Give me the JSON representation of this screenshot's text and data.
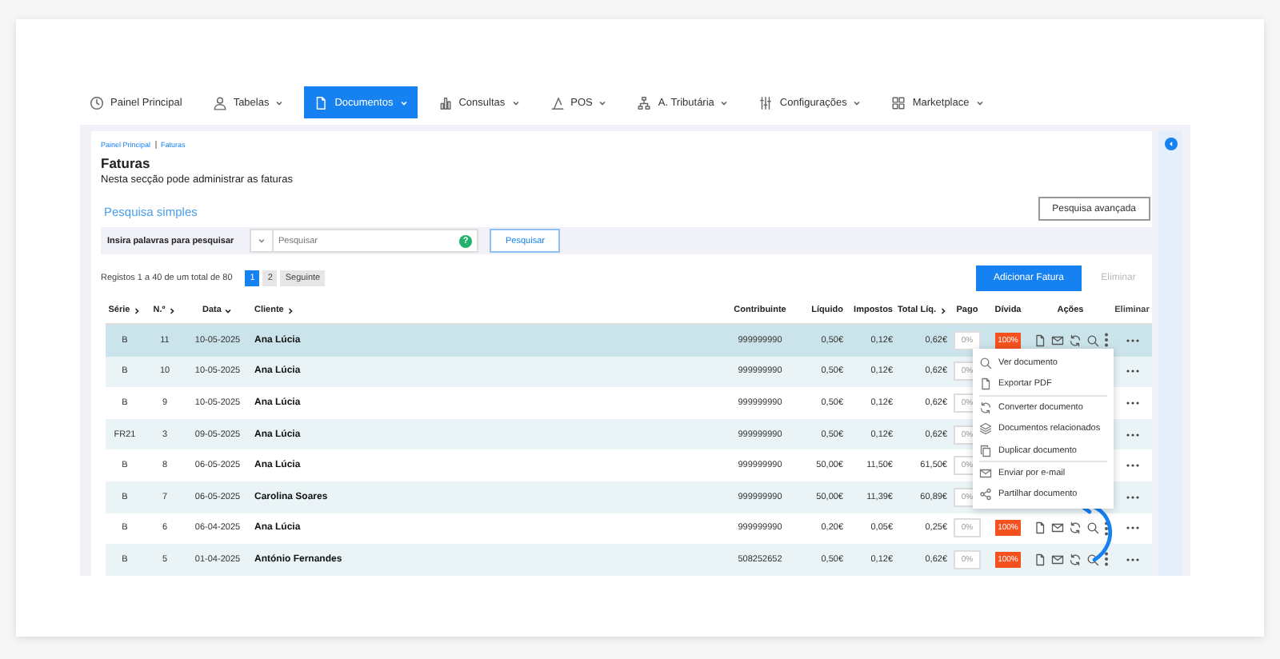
{
  "nav": [
    {
      "label": "Painel Principal",
      "selected": false,
      "dropdown": false
    },
    {
      "label": "Tabelas",
      "selected": false,
      "dropdown": true
    },
    {
      "label": "Documentos",
      "selected": true,
      "dropdown": true
    },
    {
      "label": "Consultas",
      "selected": false,
      "dropdown": true
    },
    {
      "label": "POS",
      "selected": false,
      "dropdown": true
    },
    {
      "label": "A. Tributária",
      "selected": false,
      "dropdown": true
    },
    {
      "label": "Configurações",
      "selected": false,
      "dropdown": true
    },
    {
      "label": "Marketplace",
      "selected": false,
      "dropdown": true
    }
  ],
  "breadcrumb": [
    "Painel Principal",
    "Faturas"
  ],
  "title": "Faturas",
  "subtitle": "Nesta secção pode administrar as faturas",
  "advanced_search_button": "Pesquisa avançada",
  "simple_search_title": "Pesquisa simples",
  "search": {
    "label": "Insira palavras para pesquisar",
    "placeholder": "Pesquisar",
    "help": "?",
    "button": "Pesquisar"
  },
  "records": "Registos 1 a 40 de um total de 80",
  "pages": [
    {
      "label": "1",
      "selected": true
    },
    {
      "label": "2",
      "selected": false
    },
    {
      "label": "Seguinte",
      "selected": false
    }
  ],
  "add_button": "Adicionar Fatura",
  "delete_button": {
    "label": "Eliminar",
    "disabled": true
  },
  "table": {
    "columns": [
      {
        "label": "Série",
        "sortable": true,
        "sorted": false
      },
      {
        "label": "N.º",
        "sortable": true,
        "sorted": false
      },
      {
        "label": "Data",
        "sortable": true,
        "sorted": true
      },
      {
        "label": "Cliente",
        "sortable": true,
        "sorted": false
      },
      {
        "label": "Contribuinte",
        "sortable": false,
        "sorted": false
      },
      {
        "label": "Líquido",
        "sortable": false,
        "sorted": false
      },
      {
        "label": "Impostos",
        "sortable": false,
        "sorted": false
      },
      {
        "label": "Total Líq.",
        "sortable": true,
        "sorted": false
      },
      {
        "label": "Pago",
        "sortable": false,
        "sorted": false
      },
      {
        "label": "Dívida",
        "sortable": false,
        "sorted": false
      },
      {
        "label": "Ações",
        "sortable": false,
        "sorted": false
      },
      {
        "label": "Eliminar",
        "sortable": false,
        "sorted": false
      }
    ],
    "rows": [
      {
        "serie": "B",
        "num": "11",
        "date": "10-05-2025",
        "client": "Ana Lúcia",
        "nif": "999999990",
        "net": "0,50€",
        "tax": "0,12€",
        "total": "0,62€",
        "paid": "0%",
        "debt": "100%",
        "selected": true
      },
      {
        "serie": "B",
        "num": "10",
        "date": "10-05-2025",
        "client": "Ana Lúcia",
        "nif": "999999990",
        "net": "0,50€",
        "tax": "0,12€",
        "total": "0,62€",
        "paid": "0%",
        "selected": false
      },
      {
        "serie": "B",
        "num": "9",
        "date": "10-05-2025",
        "client": "Ana Lúcia",
        "nif": "999999990",
        "net": "0,50€",
        "tax": "0,12€",
        "total": "0,62€",
        "paid": "0%",
        "selected": false
      },
      {
        "serie": "FR21",
        "num": "3",
        "date": "09-05-2025",
        "client": "Ana Lúcia",
        "nif": "999999990",
        "net": "0,50€",
        "tax": "0,12€",
        "total": "0,62€",
        "paid": "0%",
        "selected": false
      },
      {
        "serie": "B",
        "num": "8",
        "date": "06-05-2025",
        "client": "Ana Lúcia",
        "nif": "999999990",
        "net": "50,00€",
        "tax": "11,50€",
        "total": "61,50€",
        "paid": "0%",
        "selected": false
      },
      {
        "serie": "B",
        "num": "7",
        "date": "06-05-2025",
        "client": "Carolina Soares",
        "nif": "999999990",
        "net": "50,00€",
        "tax": "11,39€",
        "total": "60,89€",
        "paid": "0%",
        "selected": false
      },
      {
        "serie": "B",
        "num": "6",
        "date": "06-04-2025",
        "client": "Ana Lúcia",
        "nif": "999999990",
        "net": "0,20€",
        "tax": "0,05€",
        "total": "0,25€",
        "paid": "0%",
        "debt": "100%",
        "selected": false
      },
      {
        "serie": "B",
        "num": "5",
        "date": "01-04-2025",
        "client": "António Fernandes",
        "nif": "508252652",
        "net": "0,50€",
        "tax": "0,12€",
        "total": "0,62€",
        "paid": "0%",
        "debt": "100%",
        "selected": false
      }
    ],
    "context_menu": [
      {
        "label": "Ver documento",
        "divider_before": false
      },
      {
        "label": "Exportar PDF",
        "divider_before": false
      },
      {
        "label": "Converter documento",
        "divider_before": true
      },
      {
        "label": "Documentos relacionados",
        "divider_before": false
      },
      {
        "label": "Duplicar documento",
        "divider_before": false
      },
      {
        "label": "Enviar por e-mail",
        "divider_before": true
      },
      {
        "label": "Partilhar documento",
        "divider_before": false
      }
    ]
  }
}
